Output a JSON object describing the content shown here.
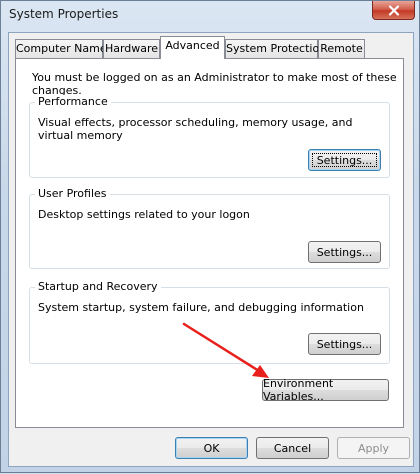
{
  "window": {
    "title": "System Properties"
  },
  "tabs": [
    {
      "label": "Computer Name"
    },
    {
      "label": "Hardware"
    },
    {
      "label": "Advanced"
    },
    {
      "label": "System Protection"
    },
    {
      "label": "Remote"
    }
  ],
  "active_tab": "Advanced",
  "admin_note": "You must be logged on as an Administrator to make most of these changes.",
  "groups": {
    "performance": {
      "label": "Performance",
      "description": "Visual effects, processor scheduling, memory usage, and virtual memory",
      "button": "Settings..."
    },
    "user_profiles": {
      "label": "User Profiles",
      "description": "Desktop settings related to your logon",
      "button": "Settings..."
    },
    "startup_recovery": {
      "label": "Startup and Recovery",
      "description": "System startup, system failure, and debugging information",
      "button": "Settings..."
    }
  },
  "environment_button": "Environment Variables...",
  "footer": {
    "ok": "OK",
    "cancel": "Cancel",
    "apply": "Apply"
  },
  "annotation": {
    "arrow_color": "#e8201c"
  }
}
